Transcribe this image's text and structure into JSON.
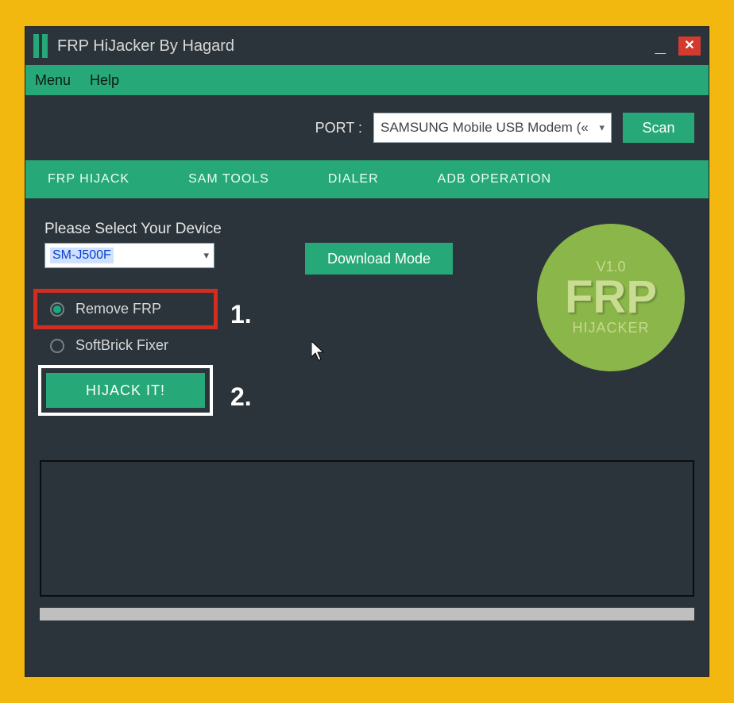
{
  "window": {
    "title": "FRP HiJacker By Hagard"
  },
  "menubar": {
    "items": [
      "Menu",
      "Help"
    ]
  },
  "portrow": {
    "label": "PORT :",
    "selected": "SAMSUNG Mobile USB Modem («",
    "scan": "Scan"
  },
  "tabs": [
    "FRP HIJACK",
    "SAM TOOLS",
    "DIALER",
    "ADB OPERATION"
  ],
  "device": {
    "label": "Please Select Your Device",
    "selected": "SM-J500F"
  },
  "buttons": {
    "download_mode": "Download Mode",
    "hijack": "HIJACK IT!"
  },
  "radios": {
    "remove_frp": "Remove FRP",
    "softbrick": "SoftBrick Fixer"
  },
  "steps": {
    "one": "1.",
    "two": "2."
  },
  "logo": {
    "version": "V1.0",
    "big": "FRP",
    "sub": "HIJACKER"
  }
}
